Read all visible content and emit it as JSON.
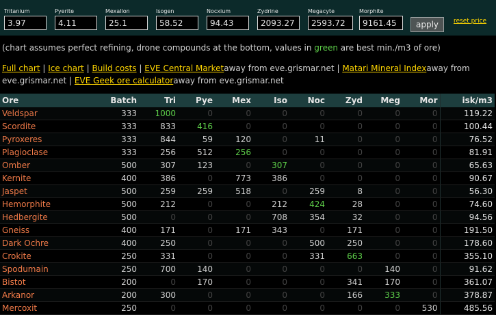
{
  "prices": [
    {
      "label": "Tritanium",
      "value": "3.97"
    },
    {
      "label": "Pyerite",
      "value": "4.11"
    },
    {
      "label": "Mexallon",
      "value": "25.1"
    },
    {
      "label": "Isogen",
      "value": "58.52"
    },
    {
      "label": "Nocxium",
      "value": "94.43"
    },
    {
      "label": "Zydrine",
      "value": "2093.27"
    },
    {
      "label": "Megacyte",
      "value": "2593.72"
    },
    {
      "label": "Morphite",
      "value": "9161.45"
    }
  ],
  "apply_label": "apply",
  "reset_label": "reset price",
  "note": {
    "before": "(chart assumes perfect refining, drone compounds at the bottom, values in ",
    "green": "green",
    "after": " are best min./m3 of ore)"
  },
  "links": {
    "full_chart": "Full chart",
    "ice_chart": "Ice chart",
    "build_costs": "Build costs",
    "eve_central": "EVE Central Market",
    "eve_central_suffix": "away from eve.grismar.net",
    "matari": "Matari Mineral Index",
    "matari_suffix": "away from eve.grismar.net",
    "eve_geek": "EVE Geek ore calculator",
    "eve_geek_suffix": "away from eve.grismar.net",
    "separator": "|"
  },
  "table": {
    "headers": [
      "Ore",
      "Batch",
      "Tri",
      "Pye",
      "Mex",
      "Iso",
      "Noc",
      "Zyd",
      "Meg",
      "Mor",
      "isk/m3"
    ],
    "rows": [
      {
        "cells": [
          "Veldspar",
          "333",
          "1000",
          "0",
          "0",
          "0",
          "0",
          "0",
          "0",
          "0",
          "119.22"
        ],
        "best": [
          2
        ]
      },
      {
        "cells": [
          "Scordite",
          "333",
          "833",
          "416",
          "0",
          "0",
          "0",
          "0",
          "0",
          "0",
          "100.44"
        ],
        "best": [
          3
        ]
      },
      {
        "cells": [
          "Pyroxeres",
          "333",
          "844",
          "59",
          "120",
          "0",
          "11",
          "0",
          "0",
          "0",
          "76.52"
        ],
        "best": []
      },
      {
        "cells": [
          "Plagioclase",
          "333",
          "256",
          "512",
          "256",
          "0",
          "0",
          "0",
          "0",
          "0",
          "81.91"
        ],
        "best": [
          4
        ]
      },
      {
        "cells": [
          "Omber",
          "500",
          "307",
          "123",
          "0",
          "307",
          "0",
          "0",
          "0",
          "0",
          "65.63"
        ],
        "best": [
          5
        ]
      },
      {
        "cells": [
          "Kernite",
          "400",
          "386",
          "0",
          "773",
          "386",
          "0",
          "0",
          "0",
          "0",
          "90.67"
        ],
        "best": []
      },
      {
        "cells": [
          "Jaspet",
          "500",
          "259",
          "259",
          "518",
          "0",
          "259",
          "8",
          "0",
          "0",
          "56.30"
        ],
        "best": []
      },
      {
        "cells": [
          "Hemorphite",
          "500",
          "212",
          "0",
          "0",
          "212",
          "424",
          "28",
          "0",
          "0",
          "74.60"
        ],
        "best": [
          6
        ]
      },
      {
        "cells": [
          "Hedbergite",
          "500",
          "0",
          "0",
          "0",
          "708",
          "354",
          "32",
          "0",
          "0",
          "94.56"
        ],
        "best": []
      },
      {
        "cells": [
          "Gneiss",
          "400",
          "171",
          "0",
          "171",
          "343",
          "0",
          "171",
          "0",
          "0",
          "191.50"
        ],
        "best": []
      },
      {
        "cells": [
          "Dark Ochre",
          "400",
          "250",
          "0",
          "0",
          "0",
          "500",
          "250",
          "0",
          "0",
          "178.60"
        ],
        "best": []
      },
      {
        "cells": [
          "Crokite",
          "250",
          "331",
          "0",
          "0",
          "0",
          "331",
          "663",
          "0",
          "0",
          "355.10"
        ],
        "best": [
          7
        ]
      },
      {
        "cells": [
          "Spodumain",
          "250",
          "700",
          "140",
          "0",
          "0",
          "0",
          "0",
          "140",
          "0",
          "91.62"
        ],
        "best": []
      },
      {
        "cells": [
          "Bistot",
          "200",
          "0",
          "170",
          "0",
          "0",
          "0",
          "341",
          "170",
          "0",
          "361.07"
        ],
        "best": []
      },
      {
        "cells": [
          "Arkanor",
          "200",
          "300",
          "0",
          "0",
          "0",
          "0",
          "166",
          "333",
          "0",
          "378.87"
        ],
        "best": [
          8
        ]
      },
      {
        "cells": [
          "Mercoxit",
          "250",
          "0",
          "0",
          "0",
          "0",
          "0",
          "0",
          "0",
          "530",
          "485.56"
        ],
        "best": []
      }
    ]
  }
}
